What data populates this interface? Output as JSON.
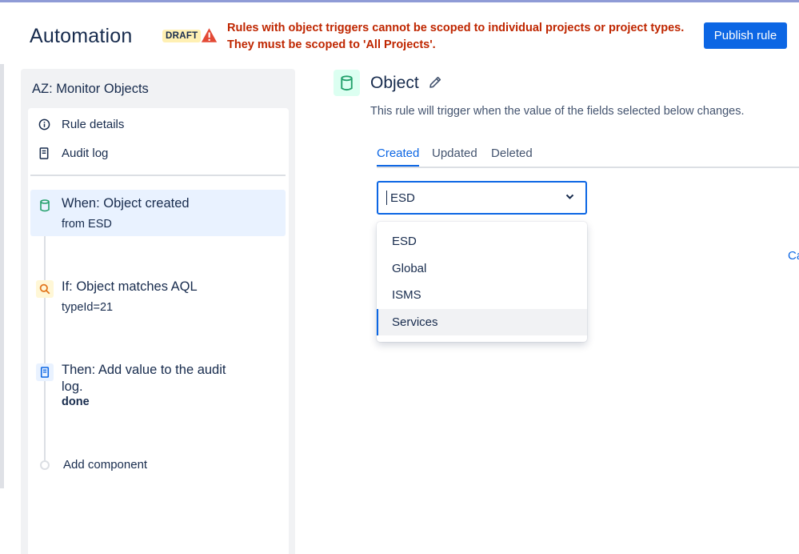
{
  "header": {
    "title": "Automation",
    "badge": "DRAFT",
    "warning": "Rules with object triggers cannot be scoped to individual projects or project types. They must be scoped to 'All Projects'.",
    "publish_label": "Publish rule"
  },
  "rule": {
    "name": "AZ: Monitor Objects",
    "nav": [
      {
        "label": "Rule details",
        "icon": "info-icon"
      },
      {
        "label": "Audit log",
        "icon": "audit-log-icon"
      }
    ],
    "steps": [
      {
        "title": "When: Object created",
        "subtitle": "from ESD",
        "icon": "object-icon",
        "selected": true
      },
      {
        "title": "If: Object matches AQL",
        "subtitle": "typeId=21",
        "icon": "search-icon",
        "selected": false
      },
      {
        "title": "Then: Add value to the audit log.",
        "subtitle": "done",
        "icon": "audit-log-icon",
        "selected": false
      }
    ],
    "add_component": "Add component"
  },
  "detail": {
    "title": "Object",
    "description": "This rule will trigger when the value of the fields selected below changes.",
    "tabs": [
      "Created",
      "Updated",
      "Deleted"
    ],
    "active_tab": "Created",
    "select_value": "ESD",
    "options": [
      "ESD",
      "Global",
      "ISMS",
      "Services"
    ],
    "hovered_option": "Services",
    "cut_link": "Ca"
  },
  "colors": {
    "primary": "#0c66e4",
    "warning_text": "#bf2600",
    "draft_badge": "#fff0b3",
    "selected_step": "#e9f2ff"
  }
}
